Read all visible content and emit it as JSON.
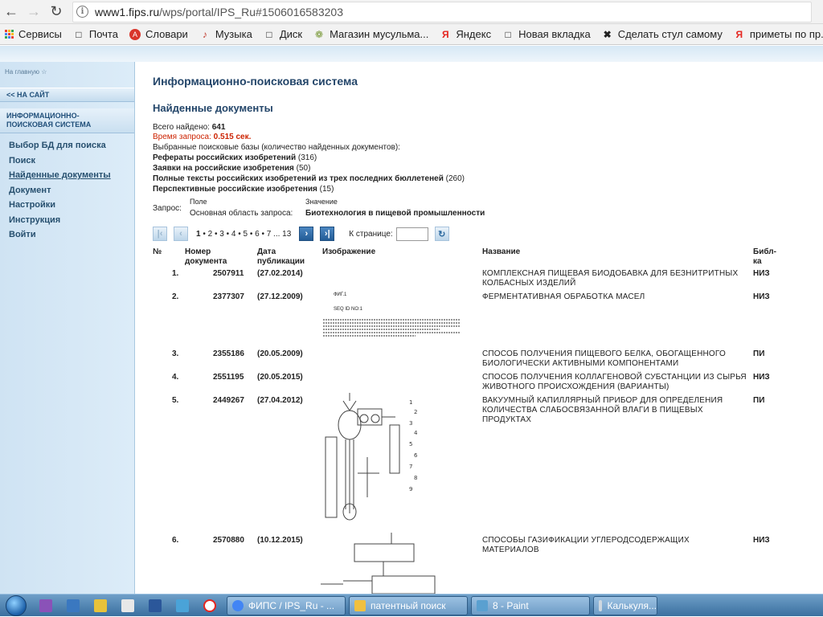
{
  "browser": {
    "url_host": "www1.fips.ru",
    "url_path": "/wps/portal/IPS_Ru#1506016583203",
    "bookmarks": [
      "Сервисы",
      "Почта",
      "Словари",
      "Музыка",
      "Диск",
      "Магазин мусульма...",
      "Яндекс",
      "Новая вкладка",
      "Сделать стул самому",
      "приметы по пр..."
    ]
  },
  "sidebar": {
    "home_link": "На главную",
    "back_link": "<< НА САЙТ",
    "section_title_1": "ИНФОРМАЦИОННО-",
    "section_title_2": "ПОИСКОВАЯ СИСТЕМА",
    "menu": [
      "Выбор БД для поиска",
      "Поиск",
      "Найденные документы",
      "Документ",
      "Настройки",
      "Инструкция",
      "Войти"
    ]
  },
  "content": {
    "main_title": "Информационно-поисковая система",
    "sub_title": "Найденные документы",
    "total_label": "Всего найдено:",
    "total_value": "641",
    "time_label": "Время запроса:",
    "time_value": "0.515 сек.",
    "selected_db_label": "Выбранные поисковые базы (количество найденных документов):",
    "databases": [
      {
        "name": "Рефераты российских изобретений",
        "count": "(316)"
      },
      {
        "name": "Заявки на российские изобретения",
        "count": "(50)"
      },
      {
        "name": "Полные тексты российских изобретений из трех последних бюллетеней",
        "count": "(260)"
      },
      {
        "name": "Перспективные российские изобретения",
        "count": "(15)"
      }
    ],
    "query_label": "Запрос:",
    "query_field_header": "Поле",
    "query_value_header": "Значение",
    "query_field": "Основная область запроса:",
    "query_value": "Биотехнология в пищевой промышленности"
  },
  "pager": {
    "current": "1",
    "pages": "• 2 • 3 • 4 • 5 • 6 • 7 ... 13",
    "goto_label": "К странице:"
  },
  "table": {
    "headers": {
      "num": "№",
      "docnum_1": "Номер",
      "docnum_2": "документа",
      "date_1": "Дата",
      "date_2": "публикации",
      "image": "Изображение",
      "title": "Название",
      "lib_1": "Библ-",
      "lib_2": "ка"
    },
    "rows": [
      {
        "n": "1.",
        "doc": "2507911",
        "date": "(27.02.2014)",
        "title": "КОМПЛЕКСНАЯ ПИЩЕВАЯ БИОДОБАВКА ДЛЯ БЕЗНИТРИТНЫХ КОЛБАСНЫХ ИЗДЕЛИЙ",
        "lib": "НИЗ"
      },
      {
        "n": "2.",
        "doc": "2377307",
        "date": "(27.12.2009)",
        "title": "ФЕРМЕНТАТИВНАЯ ОБРАБОТКА МАСЕЛ",
        "lib": "НИЗ"
      },
      {
        "n": "3.",
        "doc": "2355186",
        "date": "(20.05.2009)",
        "title": "СПОСОБ ПОЛУЧЕНИЯ ПИЩЕВОГО БЕЛКА, ОБОГАЩЕННОГО БИОЛОГИЧЕСКИ АКТИВНЫМИ КОМПОНЕНТАМИ",
        "lib": "ПИ"
      },
      {
        "n": "4.",
        "doc": "2551195",
        "date": "(20.05.2015)",
        "title": "СПОСОБ ПОЛУЧЕНИЯ КОЛЛАГЕНОВОЙ СУБСТАНЦИИ ИЗ СЫРЬЯ ЖИВОТНОГО ПРОИСХОЖДЕНИЯ (ВАРИАНТЫ)",
        "lib": "НИЗ"
      },
      {
        "n": "5.",
        "doc": "2449267",
        "date": "(27.04.2012)",
        "title": "ВАКУУМНЫЙ КАПИЛЛЯРНЫЙ ПРИБОР ДЛЯ ОПРЕДЕЛЕНИЯ КОЛИЧЕСТВА СЛАБОСВЯЗАННОЙ ВЛАГИ В ПИЩЕВЫХ ПРОДУКТАХ",
        "lib": "ПИ"
      },
      {
        "n": "6.",
        "doc": "2570880",
        "date": "(10.12.2015)",
        "title": "СПОСОБЫ ГАЗИФИКАЦИИ УГЛЕРОДСОДЕРЖАЩИХ МАТЕРИАЛОВ",
        "lib": "НИЗ"
      }
    ],
    "row2_image_text_1": "ФИГ.1",
    "row2_image_text_2": "SEQ ID NO:1"
  },
  "taskbar": {
    "tasks": [
      "ФИПС / IPS_Ru - ...",
      "патентный поиск",
      "8 - Paint",
      "Калькуля..."
    ]
  }
}
